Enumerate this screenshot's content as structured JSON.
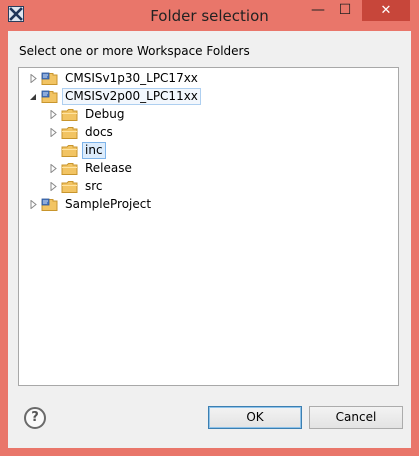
{
  "window": {
    "title": "Folder selection",
    "buttons": {
      "minimize": "—",
      "maximize": "☐",
      "close": "✕"
    }
  },
  "prompt": "Select one or more Workspace Folders",
  "tree": [
    {
      "label": "CMSISv1p30_LPC17xx",
      "kind": "project",
      "depth": 0,
      "expander": "collapsed",
      "state": ""
    },
    {
      "label": "CMSISv2p00_LPC11xx",
      "kind": "project",
      "depth": 0,
      "expander": "expanded",
      "state": "highlighted"
    },
    {
      "label": "Debug",
      "kind": "folder",
      "depth": 1,
      "expander": "collapsed",
      "state": ""
    },
    {
      "label": "docs",
      "kind": "folder",
      "depth": 1,
      "expander": "collapsed",
      "state": ""
    },
    {
      "label": "inc",
      "kind": "folder",
      "depth": 1,
      "expander": "none",
      "state": "selected"
    },
    {
      "label": "Release",
      "kind": "folder",
      "depth": 1,
      "expander": "collapsed",
      "state": ""
    },
    {
      "label": "src",
      "kind": "folder",
      "depth": 1,
      "expander": "collapsed",
      "state": ""
    },
    {
      "label": "SampleProject",
      "kind": "project",
      "depth": 0,
      "expander": "collapsed",
      "state": ""
    }
  ],
  "footer": {
    "help_glyph": "?",
    "ok_label": "OK",
    "cancel_label": "Cancel"
  },
  "icons": {
    "app": "eclipse-x-icon",
    "folder": "folder-icon",
    "project": "project-folder-icon",
    "help": "help-icon"
  },
  "colors": {
    "titlebar": "#e9766a",
    "close_button": "#c7463a",
    "selection_fill": "#dcecfc",
    "selection_border": "#7eb4ea"
  }
}
